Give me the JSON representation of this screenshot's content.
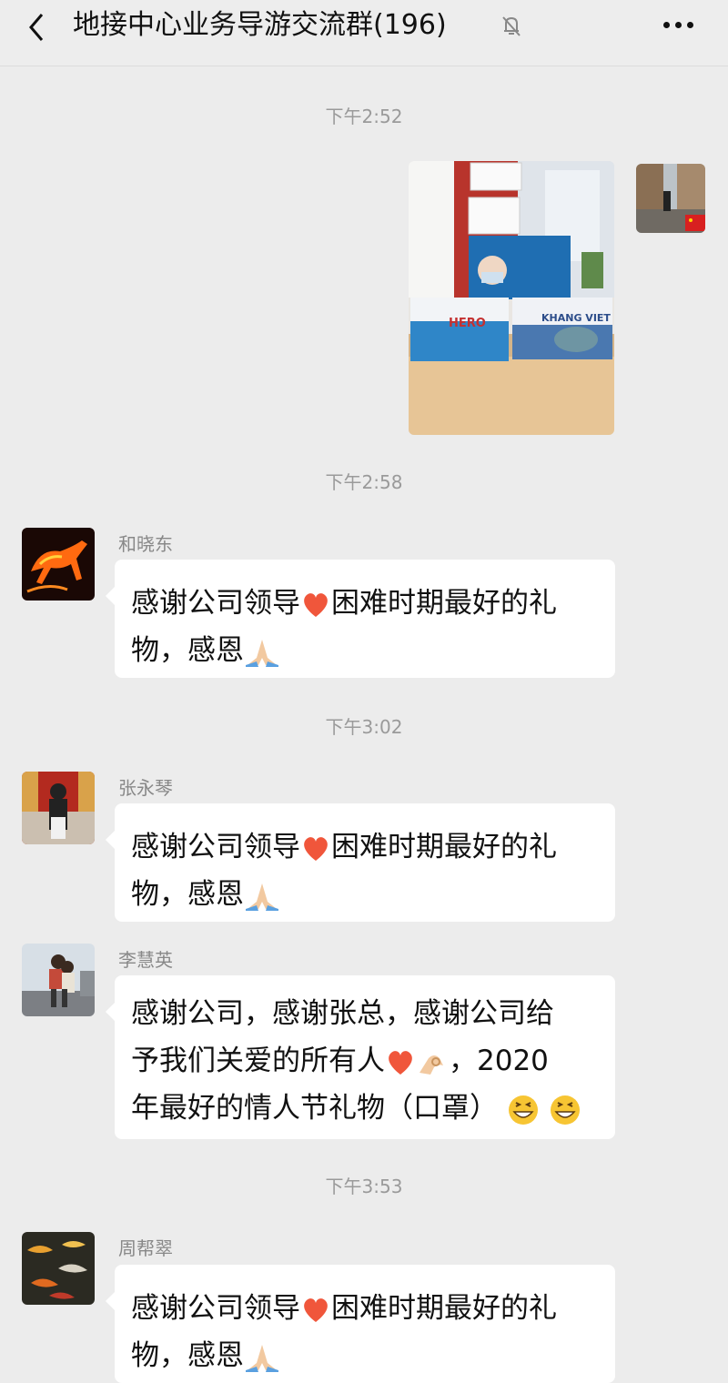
{
  "header": {
    "title": "地接中心业务导游交流群(196)"
  },
  "colors": {
    "background": "#ececec",
    "bubble": "#ffffff",
    "heart": "#f0563b",
    "timestamp": "#9a9a9a"
  },
  "icons": {
    "back": "chevron-left-icon",
    "mute": "bell-off-icon",
    "more": "more-dots-icon",
    "heart": "heart-emoji",
    "pray": "folded-hands-emoji",
    "ok": "ok-hand-emoji",
    "grin": "grinning-emoji"
  },
  "messages": [
    {
      "time": "下午2:52",
      "type": "image",
      "sender": "self",
      "image_text": {
        "box_a": "HERO",
        "box_b": "KHANG VIET"
      }
    },
    {
      "time": "下午2:58",
      "sender": "和晓东",
      "line1_a": "感谢公司领导",
      "line1_b": "困难时期最好的礼",
      "line2": "物，感恩"
    },
    {
      "time": "下午3:02",
      "sender": "张永琴",
      "line1_a": "感谢公司领导",
      "line1_b": "困难时期最好的礼",
      "line2": "物，感恩"
    },
    {
      "sender": "李慧英",
      "line1": "感谢公司，感谢张总，感谢公司给",
      "line2_a": "予我们关爱的所有人",
      "line2_b": "，2020",
      "line3": "年最好的情人节礼物（口罩）"
    },
    {
      "time": "下午3:53",
      "sender": "周帮翠",
      "line1_a": "感谢公司领导",
      "line1_b": "困难时期最好的礼",
      "line2": "物，感恩"
    }
  ]
}
